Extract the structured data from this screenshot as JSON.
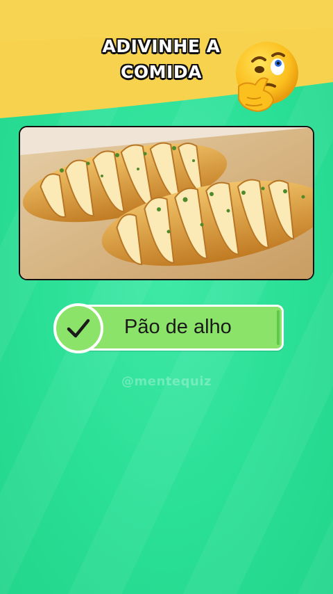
{
  "quiz": {
    "title_line1": "ADIVINHE A",
    "title_line2": "COMIDA",
    "answer": "Pão de alho",
    "answer_state": "correct",
    "watermark": "@mentequiz"
  },
  "icons": {
    "emoji": "thinking-face-icon",
    "check": "checkmark-icon"
  },
  "colors": {
    "header_yellow": "#f6d24f",
    "background_green": "#2ee39a",
    "answer_green": "#8ce36a",
    "title_text": "#ffffff"
  }
}
